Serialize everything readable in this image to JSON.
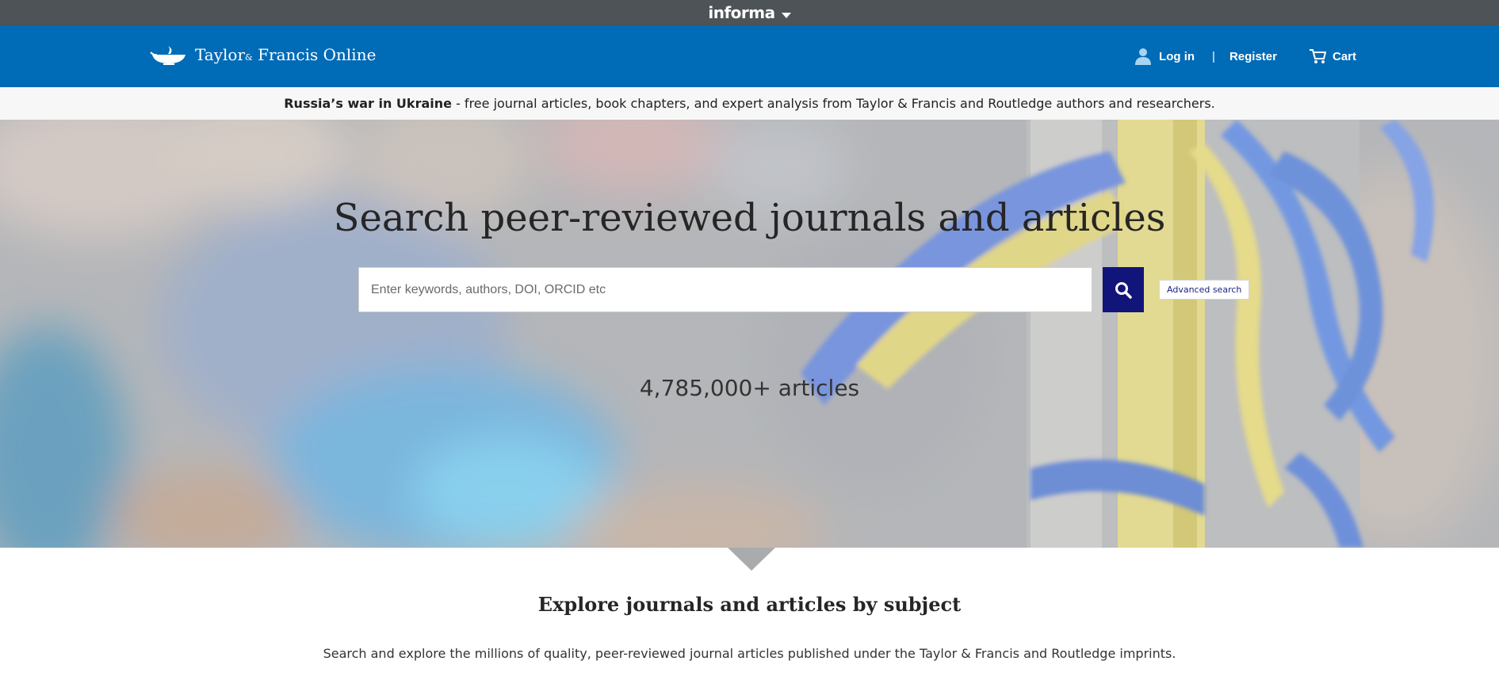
{
  "informa_bar": {
    "brand": "informa",
    "dropdown_icon": "caret-down-icon"
  },
  "header": {
    "logo": {
      "brand": "Taylor",
      "amp": "&",
      "rest": "Francis Online",
      "icon": "lamp-logo-icon"
    },
    "login": "Log in",
    "separator": "|",
    "register": "Register",
    "cart": "Cart",
    "icons": {
      "user": "user-icon",
      "cart": "cart-icon"
    }
  },
  "notice": {
    "bold": "Russia’s war in Ukraine",
    "text": " - free journal articles, book chapters, and expert analysis from Taylor & Francis and Routledge authors and researchers."
  },
  "hero": {
    "title": "Search peer-reviewed journals and articles",
    "search_placeholder": "Enter keywords, authors, DOI, ORCID etc",
    "search_value": "",
    "search_icon": "search-icon",
    "advanced_search": "Advanced search",
    "article_count": "4,785,000+ articles"
  },
  "explore": {
    "title": "Explore journals and articles by subject",
    "description": "Search and explore the millions of quality, peer-reviewed journal articles published under the Taylor & Francis and Routledge imprints."
  },
  "colors": {
    "informa_bar": "#4d5357",
    "header": "#006bb6",
    "search_button": "#11157a",
    "notice_bg": "#f7f7f7",
    "ribbon_yellow": "#e4d36e",
    "ribbon_blue": "#4a78d8"
  }
}
